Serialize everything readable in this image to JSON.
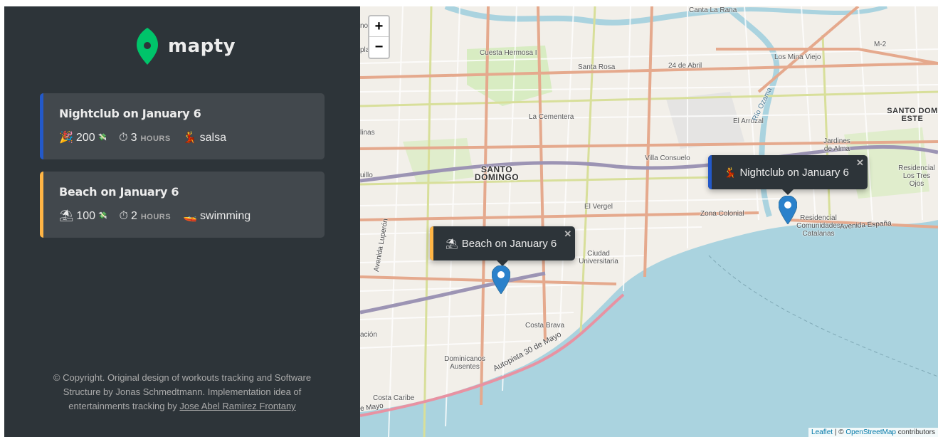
{
  "brand": {
    "name": "mapty",
    "color": "#00c46a"
  },
  "workouts": [
    {
      "title": "Nightclub on January 6",
      "stripe_color": "#2359c9",
      "value_emoji": "🎉",
      "value": "200",
      "value_suffix_emoji": "💸",
      "duration_emoji": "⏱",
      "duration": "3",
      "duration_unit": "HOURS",
      "activity_emoji": "💃",
      "activity": "salsa"
    },
    {
      "title": "Beach on January 6",
      "stripe_color": "#ffb545",
      "value_emoji": "⛱",
      "value": "100",
      "value_suffix_emoji": "💸",
      "duration_emoji": "⏱",
      "duration": "2",
      "duration_unit": "HOURS",
      "activity_emoji": "🚤",
      "activity": "swimming"
    }
  ],
  "copyright": {
    "text": "© Copyright. Original design of workouts tracking and Software Structure by Jonas Schmedtmann. Implementation idea of entertainments tracking by",
    "author_link": "Jose Abel Ramirez Frontany"
  },
  "map": {
    "zoom_in": "+",
    "zoom_out": "−",
    "popups": [
      {
        "emoji": "💃",
        "text": "Nightclub on January 6",
        "close": "✕",
        "color": "#2359c9"
      },
      {
        "emoji": "⛱",
        "text": "Beach on January 6",
        "close": "✕",
        "color": "#ffb545"
      }
    ],
    "labels": {
      "cuesta_hermosa": "Cuesta Hermosa I",
      "santa_rosa": "Santa Rosa",
      "dia_24_abril": "24 de Abril",
      "canta_la_rana": "Canta La Rana",
      "los_mina_viejo": "Los Mina Viejo",
      "la_cementera": "La Cementera",
      "santo_domingo": "SANTO DOMINGO",
      "santo_domingo_este": "SANTO DOM ESTE",
      "el_arrozal": "El Arrozal",
      "jardines_de_alma": "Jardines de Alma",
      "villa_consuelo": "Villa Consuelo",
      "residencial_las_tres_ojos": "Residencial Los Tres Ojos",
      "el_vergel": "El Vergel",
      "zona_colonial": "Zona Colonial",
      "residencial_comunidades_catalanas": "Residencial Comunidades Catalanas",
      "avenida_espana": "Avenida España",
      "ciudad_universitaria": "Ciudad Universitaria",
      "costa_brava": "Costa Brava",
      "dominicanos_ausentes": "Dominicanos Ausentes",
      "costa_caribe": "Costa Caribe",
      "autopista_30_de_mayo": "Autopista 30 de Mayo",
      "avenida_luperon": "Avenida Luperón",
      "rio_ozama": "Río Ozama",
      "m2": "M-2",
      "edge_no": "no",
      "edge_pla": "pla",
      "edge_linas": "linas",
      "edge_uillo": "uillo",
      "edge_acion": "ación",
      "edge_mayo": "e Mayo"
    },
    "attribution": {
      "leaflet": "Leaflet",
      "separator": " | © ",
      "osm": "OpenStreetMap",
      "contributors": " contributors"
    },
    "colors": {
      "sea": "#aad3df",
      "land": "#f2efe9",
      "primary_road": "#e9ab8e",
      "secondary_road": "#d4dc8c",
      "trunk": "#9c94b4",
      "marker": "#2a81cb"
    }
  }
}
